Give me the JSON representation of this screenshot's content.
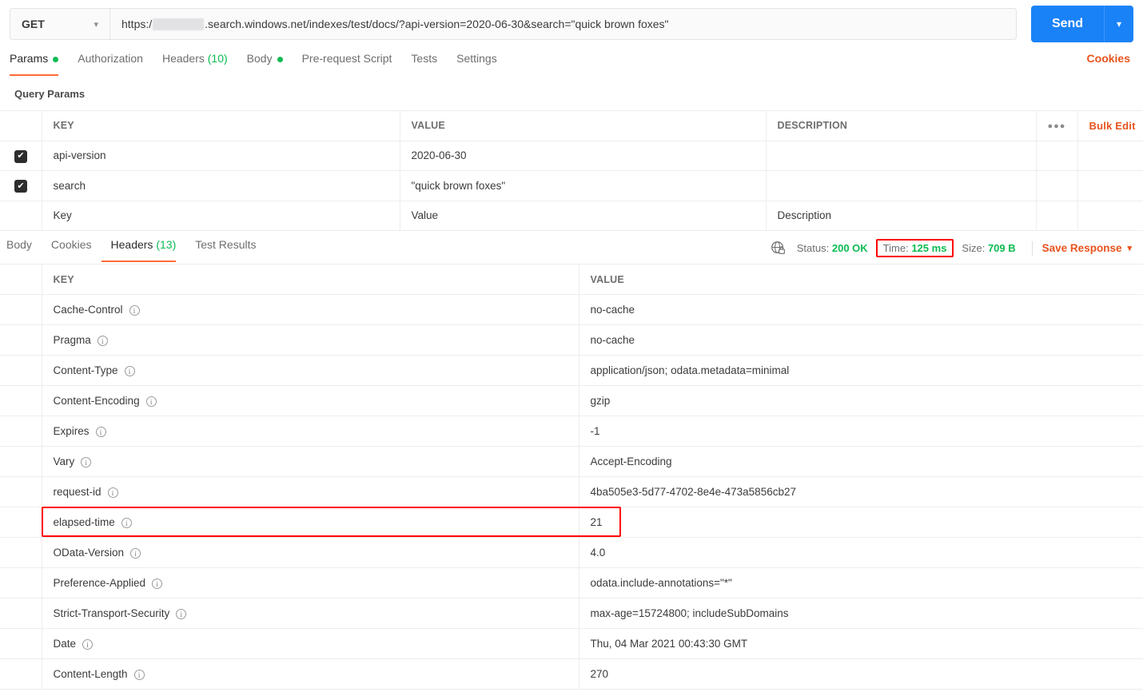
{
  "request": {
    "method": "GET",
    "method_caret": "chevron-down",
    "url_prefix": "https:/",
    "url_suffix": ".search.windows.net/indexes/test/docs/?api-version=2020-06-30&search=\"quick brown foxes\"",
    "send_label": "Send",
    "tabs": [
      {
        "label": "Params",
        "badge": "dot",
        "active": true
      },
      {
        "label": "Authorization",
        "badge": "",
        "active": false
      },
      {
        "label": "Headers",
        "badge": "(10)",
        "active": false
      },
      {
        "label": "Body",
        "badge": "dot",
        "active": false
      },
      {
        "label": "Pre-request Script",
        "badge": "",
        "active": false
      },
      {
        "label": "Tests",
        "badge": "",
        "active": false
      },
      {
        "label": "Settings",
        "badge": "",
        "active": false
      }
    ],
    "cookies_link": "Cookies"
  },
  "query_params": {
    "section_title": "Query Params",
    "columns": [
      "KEY",
      "VALUE",
      "DESCRIPTION"
    ],
    "dots_label": "●●●",
    "bulk_edit_label": "Bulk Edit",
    "check_glyph": "✔",
    "rows": [
      {
        "checked": true,
        "key": "api-version",
        "value": "2020-06-30",
        "description": ""
      },
      {
        "checked": true,
        "key": "search",
        "value": "\"quick brown foxes\"",
        "description": ""
      }
    ],
    "new_row": {
      "key_placeholder": "Key",
      "value_placeholder": "Value",
      "description_placeholder": "Description"
    }
  },
  "response": {
    "tabs": [
      {
        "label": "Body",
        "badge": "",
        "active": false
      },
      {
        "label": "Cookies",
        "badge": "",
        "active": false
      },
      {
        "label": "Headers",
        "badge": "(13)",
        "active": true
      },
      {
        "label": "Test Results",
        "badge": "",
        "active": false
      }
    ],
    "status_label": "Status:",
    "status_value": "200 OK",
    "time_label": "Time:",
    "time_value": "125 ms",
    "size_label": "Size:",
    "size_value": "709 B",
    "save_response_label": "Save Response",
    "highlight_color": "#ff0000",
    "headers_columns": [
      "KEY",
      "VALUE"
    ],
    "headers": [
      {
        "key": "Cache-Control",
        "value": "no-cache",
        "highlighted": false
      },
      {
        "key": "Pragma",
        "value": "no-cache",
        "highlighted": false
      },
      {
        "key": "Content-Type",
        "value": "application/json; odata.metadata=minimal",
        "highlighted": false
      },
      {
        "key": "Content-Encoding",
        "value": "gzip",
        "highlighted": false
      },
      {
        "key": "Expires",
        "value": "-1",
        "highlighted": false
      },
      {
        "key": "Vary",
        "value": "Accept-Encoding",
        "highlighted": false
      },
      {
        "key": "request-id",
        "value": "4ba505e3-5d77-4702-8e4e-473a5856cb27",
        "highlighted": false
      },
      {
        "key": "elapsed-time",
        "value": "21",
        "highlighted": true
      },
      {
        "key": "OData-Version",
        "value": "4.0",
        "highlighted": false
      },
      {
        "key": "Preference-Applied",
        "value": "odata.include-annotations=\"*\"",
        "highlighted": false
      },
      {
        "key": "Strict-Transport-Security",
        "value": "max-age=15724800; includeSubDomains",
        "highlighted": false
      },
      {
        "key": "Date",
        "value": "Thu, 04 Mar 2021 00:43:30 GMT",
        "highlighted": false
      },
      {
        "key": "Content-Length",
        "value": "270",
        "highlighted": false
      }
    ],
    "info_glyph": "i"
  },
  "theme": {
    "accent_orange": "#ff6c37",
    "link_orange": "#e8531d",
    "send_blue": "#1a82f7",
    "success_green": "#0cbb52",
    "highlight_red": "#ff0000"
  }
}
